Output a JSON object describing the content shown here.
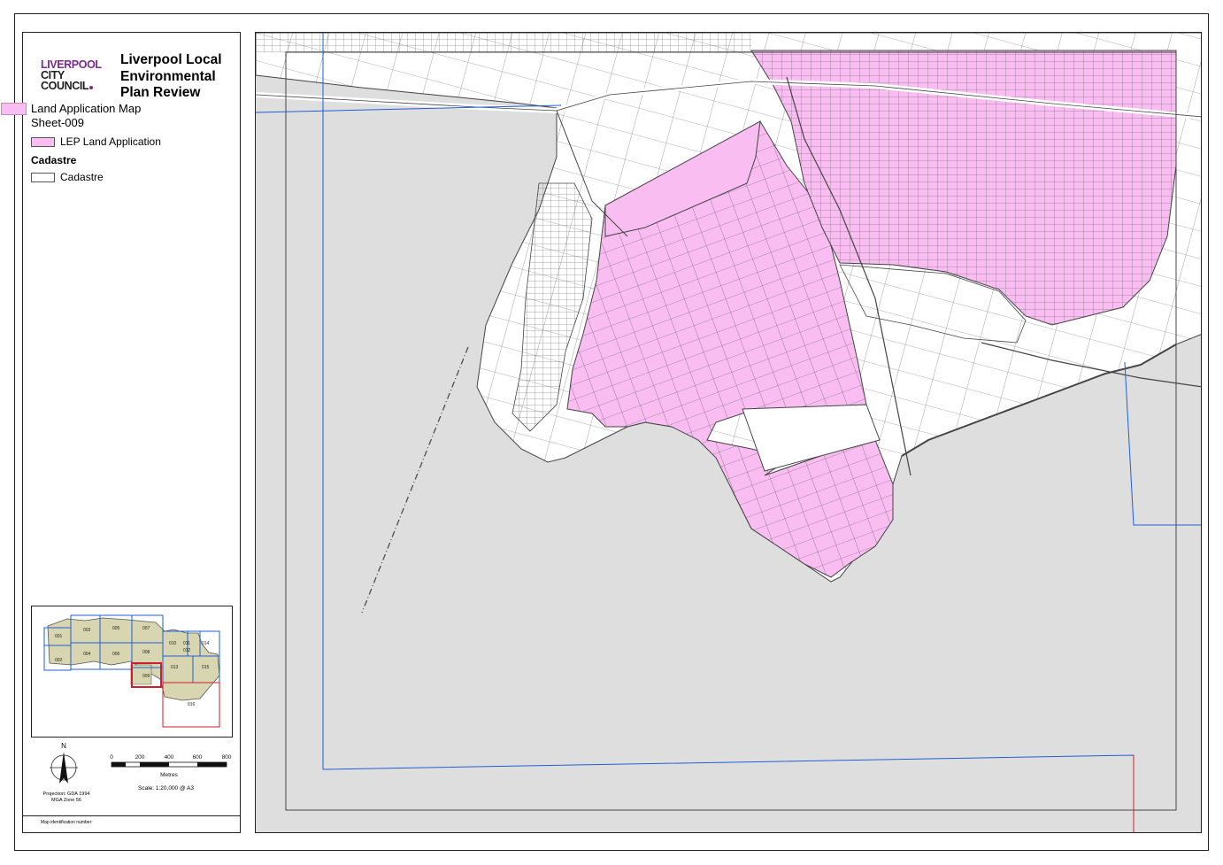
{
  "legend": {
    "logo": {
      "line1": "LIVERPOOL",
      "line2": "CITY",
      "line3": "COUNCIL"
    },
    "title": "Liverpool Local\nEnvironmental\nPlan Review",
    "sheet_title": "Land Application Map",
    "sheet_id": "Sheet-009",
    "items": [
      {
        "label": "LEP Land Application",
        "color": "#f9bdf2"
      }
    ],
    "cadastre_heading": "Cadastre",
    "cadastre_label": "Cadastre",
    "projection": "Projection: GDA 1994\nMGA Zone 56",
    "scale_text": "Scale: 1:20,000 @ A3",
    "scale_ticks": [
      "0",
      "200",
      "400",
      "600",
      "800"
    ],
    "scale_unit": "Metres",
    "north_label": "N",
    "map_id_label": "Map identification number:"
  },
  "inset": {
    "sheets": [
      "001",
      "002",
      "003",
      "004",
      "005",
      "006",
      "007",
      "008",
      "009",
      "010",
      "011",
      "012",
      "013",
      "014",
      "015",
      "016"
    ],
    "highlighted": "009"
  },
  "colors": {
    "lep": "#f9bdf2",
    "outside": "#dedede",
    "grid": "#1f5fd6",
    "highlight": "#cc1f2d"
  }
}
